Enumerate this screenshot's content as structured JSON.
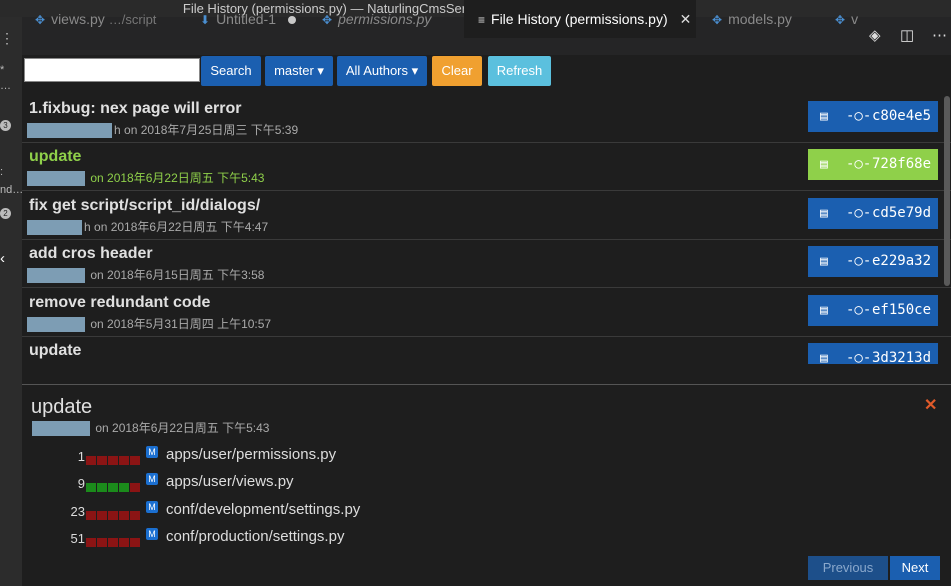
{
  "window": {
    "title": "File History (permissions.py) — NaturlingCmsServer"
  },
  "tabs": [
    {
      "name": "views.py",
      "sub": "…/script",
      "icon": "python-icon"
    },
    {
      "name": "Untitled-1",
      "icon": "download-icon",
      "dirty": true
    },
    {
      "name": "permissions.py",
      "icon": "python-icon",
      "italic": true
    },
    {
      "name": "File History (permissions.py)",
      "icon": "list-icon",
      "active": true
    },
    {
      "name": "models.py",
      "icon": "python-icon"
    },
    {
      "name": "v",
      "icon": "python-icon"
    }
  ],
  "toolbar": {
    "search_placeholder": "",
    "search_label": "Search",
    "branch_label": "master ▾",
    "authors_label": "All Authors ▾",
    "clear_label": "Clear",
    "refresh_label": "Refresh"
  },
  "commits": [
    {
      "title": "1.fixbug: nex page will error",
      "author_tail": "h",
      "date": "on 2018年7月25日周三 下午5:39",
      "hash": "c80e4e5"
    },
    {
      "title": "update",
      "author_tail": "",
      "date": "on 2018年6月22日周五 下午5:43",
      "hash": "728f68e",
      "highlighted": true
    },
    {
      "title": "fix get script/script_id/dialogs/",
      "author_tail": "h",
      "date": "on 2018年6月22日周五 下午4:47",
      "hash": "cd5e79d"
    },
    {
      "title": "add cros header",
      "author_tail": "",
      "date": "on 2018年6月15日周五 下午3:58",
      "hash": "e229a32"
    },
    {
      "title": "remove redundant code",
      "author_tail": "",
      "date": "on 2018年5月31日周四 上午10:57",
      "hash": "ef150ce"
    },
    {
      "title": "update",
      "author_tail": "",
      "date": "",
      "hash": "3d3213d"
    }
  ],
  "details": {
    "title": "update",
    "date": "on 2018年6月22日周五 下午5:43",
    "files": [
      {
        "count": "1",
        "bars": [
          "r",
          "r",
          "r",
          "r",
          "r"
        ],
        "badge": "M",
        "path": "apps/user/permissions.py"
      },
      {
        "count": "9",
        "bars": [
          "g",
          "g",
          "g",
          "g",
          "r"
        ],
        "badge": "M",
        "path": "apps/user/views.py"
      },
      {
        "count": "23",
        "bars": [
          "r",
          "r",
          "r",
          "r",
          "r"
        ],
        "badge": "M",
        "path": "conf/development/settings.py"
      },
      {
        "count": "51",
        "bars": [
          "r",
          "r",
          "r",
          "r",
          "r"
        ],
        "badge": "M",
        "path": "conf/production/settings.py"
      }
    ]
  },
  "pager": {
    "previous_label": "Previous",
    "next_label": "Next"
  },
  "sidebar_glyphs": [
    "⋮",
    "*",
    "…",
    "3",
    ":",
    "nd…",
    "2",
    "‹"
  ],
  "colors": {
    "accent": "#1b5fb0",
    "highlight": "#8fd04a",
    "clear": "#f0a030",
    "refresh": "#5bc0de",
    "close": "#e05a2a"
  }
}
